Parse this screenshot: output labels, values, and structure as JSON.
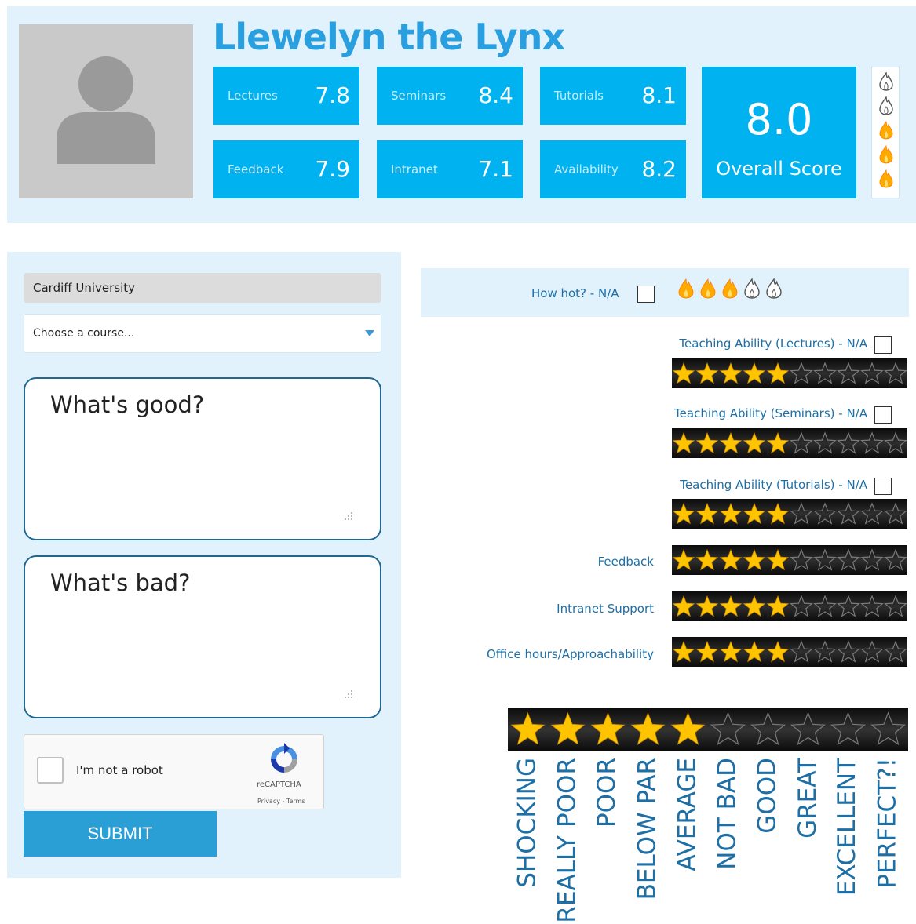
{
  "profile": {
    "name": "Llewelyn the Lynx",
    "overall_score": "8.0",
    "overall_label": "Overall Score",
    "hotness_flames": {
      "filled": 3,
      "total": 5
    }
  },
  "stats": [
    {
      "label": "Lectures",
      "value": "7.8"
    },
    {
      "label": "Seminars",
      "value": "8.4"
    },
    {
      "label": "Tutorials",
      "value": "8.1"
    },
    {
      "label": "Feedback",
      "value": "7.9"
    },
    {
      "label": "Intranet",
      "value": "7.1"
    },
    {
      "label": "Availability",
      "value": "8.2"
    }
  ],
  "form": {
    "university": "Cardiff University",
    "course_placeholder": "Choose a course...",
    "good_placeholder": "What's good?",
    "bad_placeholder": "What's bad?",
    "captcha_label": "I'm not a robot",
    "captcha_brand": "reCAPTCHA",
    "captcha_terms": "Privacy - Terms",
    "submit_label": "SUBMIT"
  },
  "ratings": {
    "hot_label": "How hot? - N/A",
    "hot_flames": {
      "filled": 3,
      "total": 5
    },
    "items": [
      {
        "label": "Teaching Ability (Lectures) - N/A",
        "stars": 5,
        "max": 10,
        "has_na": true
      },
      {
        "label": "Teaching Ability (Seminars) - N/A",
        "stars": 5,
        "max": 10,
        "has_na": true
      },
      {
        "label": "Teaching Ability (Tutorials) - N/A",
        "stars": 5,
        "max": 10,
        "has_na": true
      },
      {
        "label": "Feedback",
        "stars": 5,
        "max": 10,
        "has_na": false
      },
      {
        "label": "Intranet Support",
        "stars": 5,
        "max": 10,
        "has_na": false
      },
      {
        "label": "Office hours/Approachability",
        "stars": 5,
        "max": 10,
        "has_na": false
      }
    ],
    "scale": {
      "stars": 5,
      "max": 10,
      "labels": [
        "SHOCKING",
        "REALLY POOR",
        "POOR",
        "BELOW PAR",
        "AVERAGE",
        "NOT BAD",
        "GOOD",
        "GREAT",
        "EXCELLENT",
        "PERFECT?!"
      ]
    }
  },
  "colors": {
    "accent": "#00b2f0",
    "panel": "#e1f2fc",
    "title": "#2a9fe0",
    "link": "#1d6fa5",
    "star_fill": "#ffc400",
    "flame_fill": "#ffaa00"
  }
}
